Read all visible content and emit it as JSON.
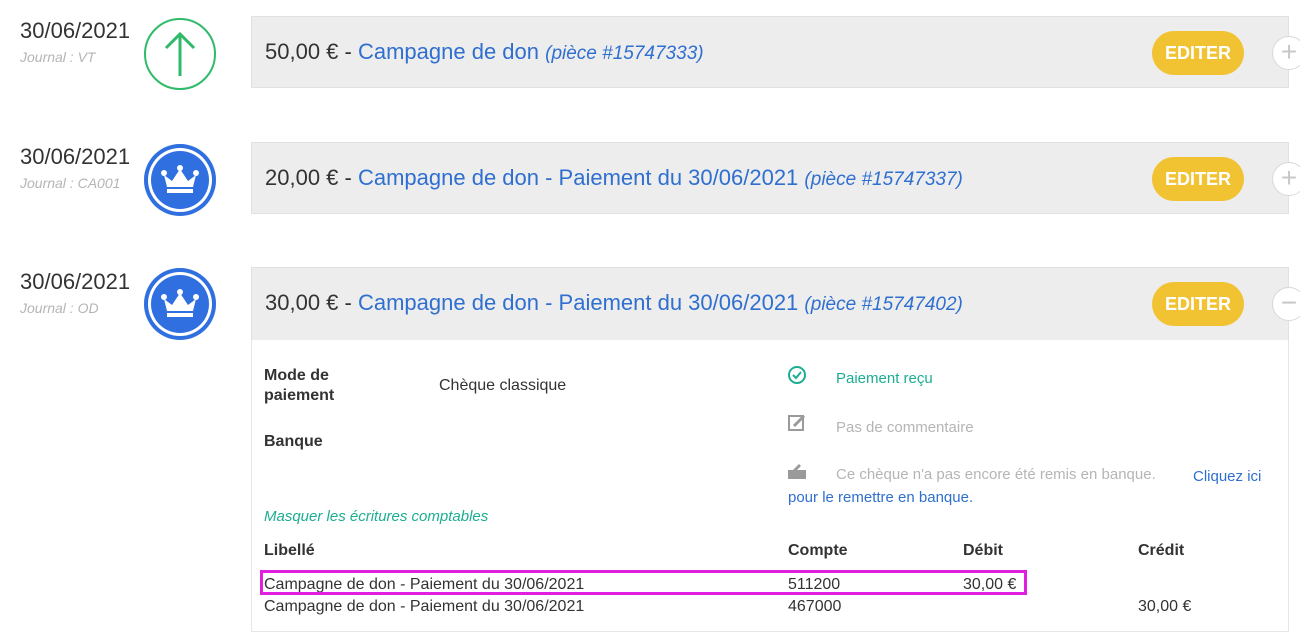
{
  "entries": [
    {
      "date": "30/06/2021",
      "journal": "Journal : VT",
      "icon": "arrow-up-icon",
      "amount": "50,00 €",
      "separator": " - ",
      "title": "Campagne de don",
      "piece": "(pièce #15747333)",
      "edit_label": "EDITER",
      "toggle": "+"
    },
    {
      "date": "30/06/2021",
      "journal": "Journal : CA001",
      "icon": "crown-icon",
      "amount": "20,00 €",
      "separator": " - ",
      "title": "Campagne de don - Paiement du 30/06/2021",
      "piece": "(pièce #15747337)",
      "edit_label": "EDITER",
      "toggle": "+"
    },
    {
      "date": "30/06/2021",
      "journal": "Journal : OD",
      "icon": "crown-icon",
      "amount": "30,00 €",
      "separator": " - ",
      "title": "Campagne de don - Paiement du 30/06/2021",
      "piece": "(pièce #15747402)",
      "edit_label": "EDITER",
      "toggle": "−"
    }
  ],
  "detail": {
    "mode_label": "Mode de paiement",
    "mode_value": "Chèque classique",
    "bank_label": "Banque",
    "status_paid": "Paiement reçu",
    "status_comment": "Pas de commentaire",
    "cheque_text": "Ce chèque n'a pas encore été remis en banque.",
    "cheque_link": "Cliquez ici pour le remettre en banque.",
    "hide_entries": "Masquer les écritures comptables",
    "table": {
      "headers": [
        "Libellé",
        "Compte",
        "Débit",
        "Crédit"
      ],
      "rows": [
        [
          "Campagne de don - Paiement du 30/06/2021",
          "511200",
          "30,00 €",
          ""
        ],
        [
          "Campagne de don - Paiement du 30/06/2021",
          "467000",
          "",
          "30,00 €"
        ]
      ]
    }
  },
  "colors": {
    "accent_blue": "#2f6fd0",
    "edit_yellow": "#f1c232",
    "success_teal": "#1cae92",
    "highlight_magenta": "#e01fe0"
  }
}
